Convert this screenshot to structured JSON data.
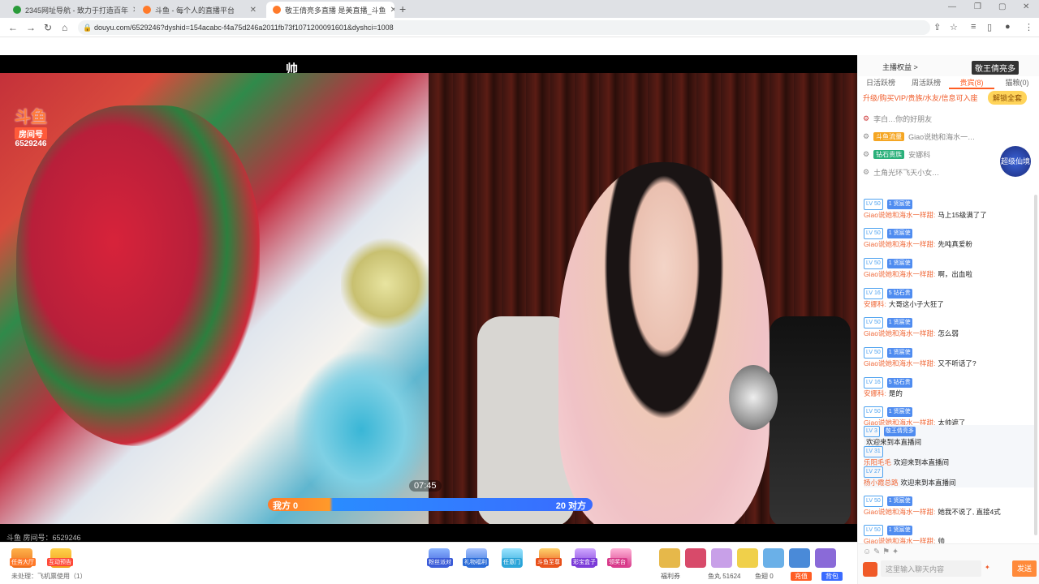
{
  "browser": {
    "tabs": [
      {
        "label": "2345网址导航 - 致力于打造百年",
        "active": false
      },
      {
        "label": "斗鱼 - 每个人的直播平台",
        "active": false
      },
      {
        "label": "敬王倩亮多直播 是美直播_斗鱼",
        "active": true
      }
    ],
    "url": "douyu.com/6529246?dyshid=154acabc-f4a75d246a2011fb73f1071200091601&dyshci=1008"
  },
  "video": {
    "overlay_text": "帅",
    "logo": {
      "brand": "斗鱼",
      "room_label": "房间号",
      "room_no": "6529246"
    },
    "pk": {
      "left_label": "我方 0",
      "right_label": "20 对方",
      "timer": "07:45"
    },
    "room_footer": "斗鱼 房间号：6529246"
  },
  "panel": {
    "header": {
      "anchor_btn": "主播权益 >",
      "title": "敬王倩亮多"
    },
    "tabs": [
      "日活跃榜",
      "周活跃榜",
      "贵宾(8)",
      "猫粮(0)"
    ],
    "vip_line": "升级/购买VIP/贵族/水友/信息可入座",
    "vip_button": "解锁全套",
    "ranks": [
      {
        "badge": "",
        "name": "李白…你的好朋友"
      },
      {
        "badge": "斗鱼流量",
        "name": "Giao说她和海水一…"
      },
      {
        "badge": "钻石贵族",
        "name": "安娜科"
      },
      {
        "badge": "",
        "name": "土角光环飞天小女…"
      }
    ],
    "badge_circle": "超级仙境",
    "chat": [
      {
        "lv": "LV 50",
        "fan": "1 贤宸使",
        "user": "Giao说她和海水一样甜:",
        "text": "马上15级满了了"
      },
      {
        "lv": "LV 50",
        "fan": "1 贤宸使",
        "user": "Giao说她和海水一样甜:",
        "text": "先吨真爱粉"
      },
      {
        "lv": "LV 50",
        "fan": "1 贤宸使",
        "user": "Giao说她和海水一样甜:",
        "text": "啊，出血啦"
      },
      {
        "lv": "LV 16",
        "fan": "5 钻石贵",
        "user": "安娜科:",
        "text": "大哥这小子大狂了"
      },
      {
        "lv": "LV 50",
        "fan": "1 贤宸使",
        "user": "Giao说她和海水一样甜:",
        "text": "怎么弱"
      },
      {
        "lv": "LV 50",
        "fan": "1 贤宸使",
        "user": "Giao说她和海水一样甜:",
        "text": "又不听话了?"
      },
      {
        "lv": "LV 16",
        "fan": "5 钻石贵",
        "user": "安娜科:",
        "text": "是的"
      },
      {
        "lv": "LV 50",
        "fan": "1 贤宸使",
        "user": "Giao说她和海水一样甜:",
        "text": "太帅遮了"
      },
      {
        "lv": "LV 3",
        "fan": "敬王倩亮多",
        "user": "",
        "text": "欢迎来到本直播间"
      },
      {
        "lv": "LV 31",
        "fan": "",
        "user": "乐阳毛毛",
        "text": "欢迎来到本直播间"
      },
      {
        "lv": "LV 27",
        "fan": "",
        "user": "杨小霞总路",
        "text": "欢迎来到本直播间"
      },
      {
        "lv": "LV 50",
        "fan": "1 贤宸使",
        "user": "Giao说她和海水一样甜:",
        "text": "她我不说了, 直接4式"
      },
      {
        "lv": "LV 50",
        "fan": "1 贤宸使",
        "user": "Giao说她和海水一样甜:",
        "text": "帅"
      }
    ],
    "chat_placeholder": "这里输入聊天内容",
    "send_label": "发送"
  },
  "giftbar": {
    "left_items": [
      "任务大厅",
      "互动预告"
    ],
    "gifts": [
      "粉丝派对",
      "礼物福利",
      "任意门",
      "斗鱼至尊",
      "彩宝盒子",
      "领奖台"
    ],
    "status": "未处理：飞机票使用（1）",
    "bottom": {
      "wall": "福利券",
      "coins": "鱼丸 51624",
      "yuchi": "鱼翅 0",
      "recharge": "充值",
      "bag": "背包"
    }
  }
}
